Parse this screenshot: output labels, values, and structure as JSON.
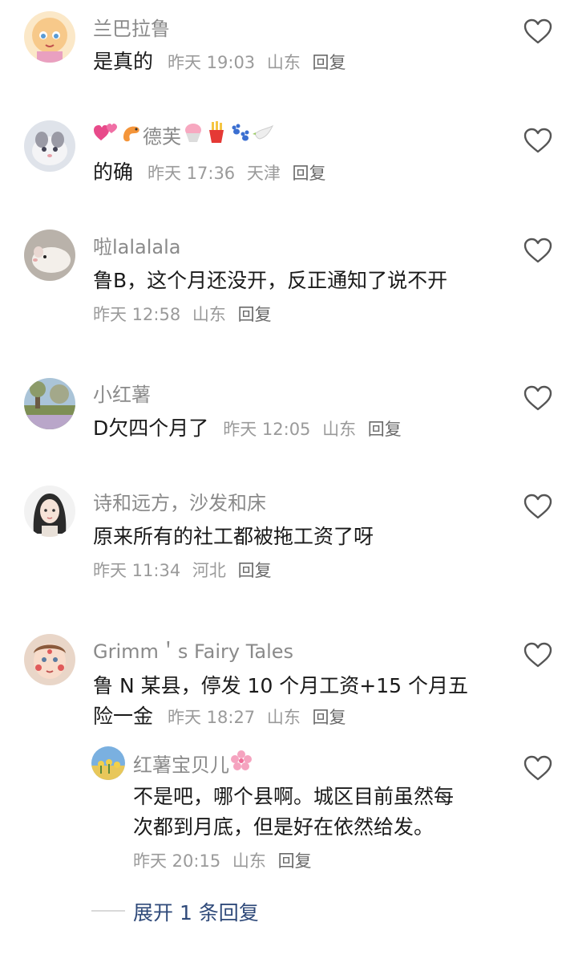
{
  "comments": [
    {
      "username": "兰巴拉鲁",
      "text": "是真的",
      "time": "昨天 19:03",
      "location": "山东",
      "reply": "回复"
    },
    {
      "username": "德芙",
      "username_emojis": [
        "two-hearts",
        "shrimp",
        "shaved-ice",
        "fries",
        "paw-prints",
        "dove"
      ],
      "text": "的确",
      "time": "昨天 17:36",
      "location": "天津",
      "reply": "回复"
    },
    {
      "username": "啦lalalala",
      "text": "鲁B，这个月还没开，反正通知了说不开",
      "time": "昨天 12:58",
      "location": "山东",
      "reply": "回复"
    },
    {
      "username": "小红薯",
      "text": "D欠四个月了",
      "time": "昨天 12:05",
      "location": "山东",
      "reply": "回复"
    },
    {
      "username": "诗和远方，沙发和床",
      "text": "原来所有的社工都被拖工资了呀",
      "time": "昨天 11:34",
      "location": "河北",
      "reply": "回复"
    },
    {
      "username": "Grimm＇s Fairy Tales",
      "text_line1": "鲁 N 某县，停发 10 个月工资+15 个月五",
      "text_line2": "险一金",
      "time": "昨天 18:27",
      "location": "山东",
      "reply": "回复"
    }
  ],
  "sub_reply": {
    "username": "红薯宝贝儿",
    "username_emoji": "cherry-blossom",
    "text_line1": "不是吧，哪个县啊。城区目前虽然每",
    "text_line2": "次都到月底，但是好在依然给发。",
    "time": "昨天 20:15",
    "location": "山东",
    "reply": "回复"
  },
  "expand": {
    "label": "展开 1 条回复"
  }
}
